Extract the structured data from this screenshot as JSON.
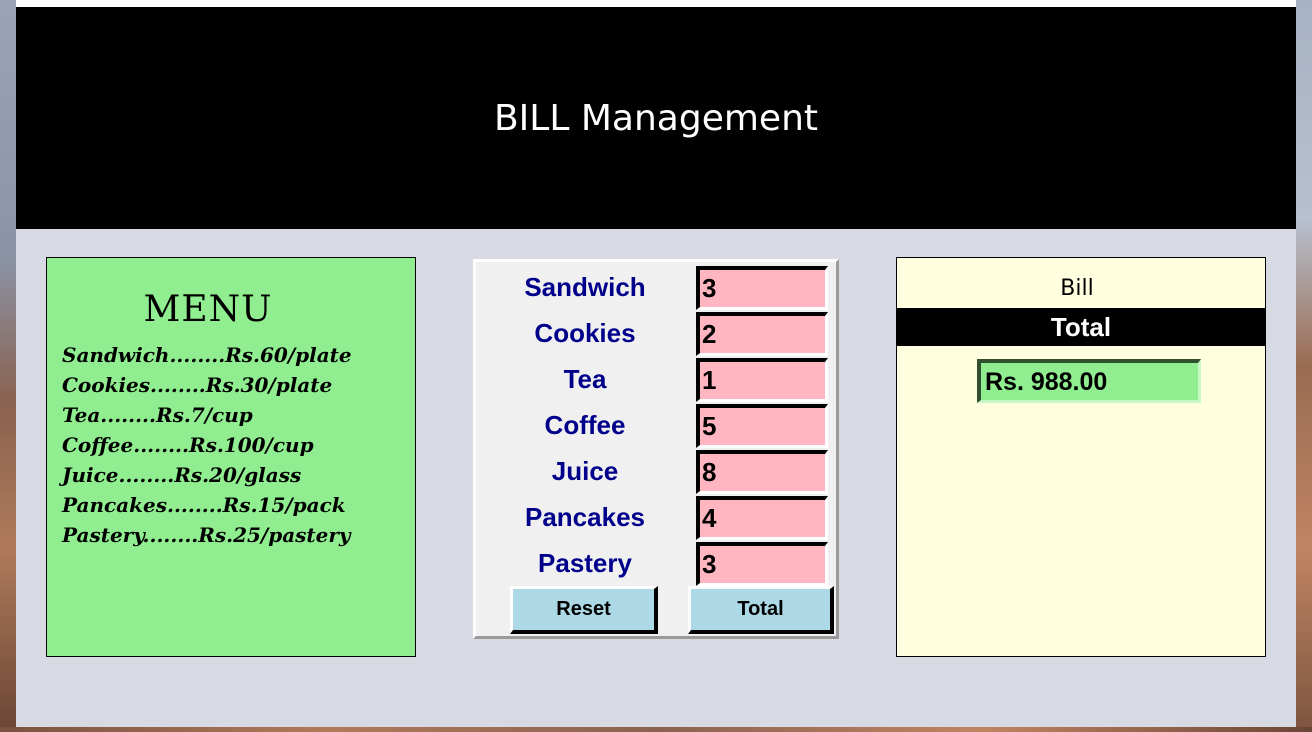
{
  "app": {
    "title": "BILL Management"
  },
  "menu": {
    "title": "MENU",
    "items": [
      "Sandwich........Rs.60/plate",
      "Cookies........Rs.30/plate",
      "Tea........Rs.7/cup",
      "Coffee........Rs.100/cup",
      "Juice........Rs.20/glass",
      "Pancakes........Rs.15/pack",
      "Pastery........Rs.25/pastery"
    ]
  },
  "order": {
    "rows": [
      {
        "label": "Sandwich",
        "value": "3"
      },
      {
        "label": "Cookies",
        "value": "2"
      },
      {
        "label": "Tea",
        "value": "1"
      },
      {
        "label": "Coffee",
        "value": "5"
      },
      {
        "label": "Juice",
        "value": "8"
      },
      {
        "label": "Pancakes",
        "value": "4"
      },
      {
        "label": "Pastery",
        "value": "3"
      }
    ],
    "reset_label": "Reset",
    "total_label": "Total"
  },
  "bill": {
    "title": "Bill",
    "total_header": "Total",
    "amount": "Rs. 988.00"
  },
  "colors": {
    "menu_bg": "#90ee90",
    "bill_bg": "#ffffe0",
    "input_bg": "#ffb6c1",
    "button_bg": "#add8e6",
    "label_color": "#00008b",
    "header_bg": "#000000"
  }
}
